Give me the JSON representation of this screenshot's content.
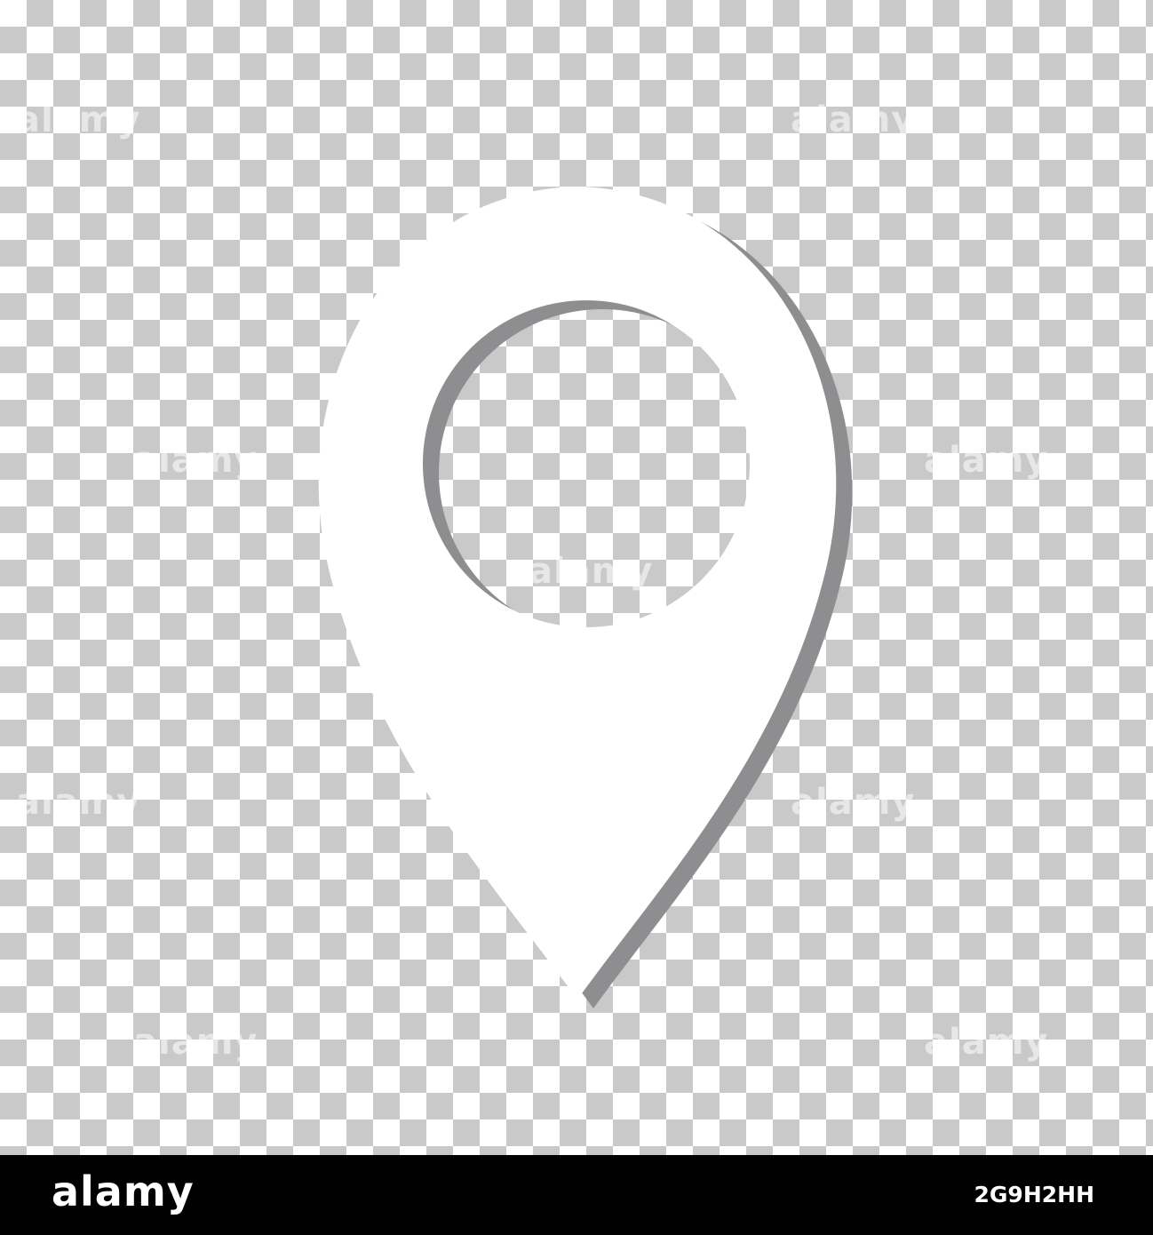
{
  "stock_photo": {
    "watermark_text": "alamy",
    "brand_logo": "alamy",
    "image_id": "2G9H2HH"
  },
  "icon": {
    "name": "map-pin-icon",
    "fill_color": "#ffffff",
    "shadow_color": "#8e8e90"
  },
  "colors": {
    "checker_light": "#ffffff",
    "checker_dark": "#c9c9c9",
    "footer_background": "#000000"
  }
}
